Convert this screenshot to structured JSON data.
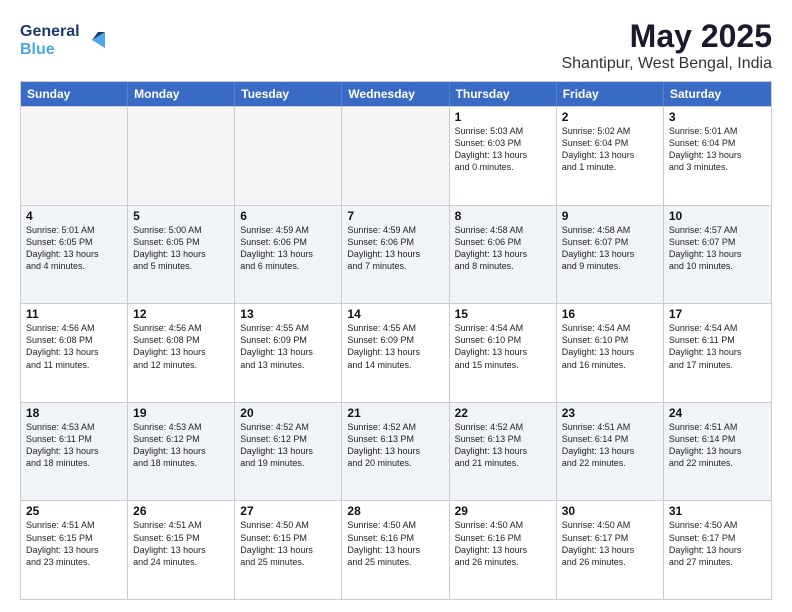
{
  "header": {
    "logo_line1": "General",
    "logo_line2": "Blue",
    "main_title": "May 2025",
    "subtitle": "Shantipur, West Bengal, India"
  },
  "weekdays": [
    "Sunday",
    "Monday",
    "Tuesday",
    "Wednesday",
    "Thursday",
    "Friday",
    "Saturday"
  ],
  "rows": [
    [
      {
        "day": "",
        "info": "",
        "empty": true
      },
      {
        "day": "",
        "info": "",
        "empty": true
      },
      {
        "day": "",
        "info": "",
        "empty": true
      },
      {
        "day": "",
        "info": "",
        "empty": true
      },
      {
        "day": "1",
        "info": "Sunrise: 5:03 AM\nSunset: 6:03 PM\nDaylight: 13 hours\nand 0 minutes."
      },
      {
        "day": "2",
        "info": "Sunrise: 5:02 AM\nSunset: 6:04 PM\nDaylight: 13 hours\nand 1 minute."
      },
      {
        "day": "3",
        "info": "Sunrise: 5:01 AM\nSunset: 6:04 PM\nDaylight: 13 hours\nand 3 minutes."
      }
    ],
    [
      {
        "day": "4",
        "info": "Sunrise: 5:01 AM\nSunset: 6:05 PM\nDaylight: 13 hours\nand 4 minutes."
      },
      {
        "day": "5",
        "info": "Sunrise: 5:00 AM\nSunset: 6:05 PM\nDaylight: 13 hours\nand 5 minutes."
      },
      {
        "day": "6",
        "info": "Sunrise: 4:59 AM\nSunset: 6:06 PM\nDaylight: 13 hours\nand 6 minutes."
      },
      {
        "day": "7",
        "info": "Sunrise: 4:59 AM\nSunset: 6:06 PM\nDaylight: 13 hours\nand 7 minutes."
      },
      {
        "day": "8",
        "info": "Sunrise: 4:58 AM\nSunset: 6:06 PM\nDaylight: 13 hours\nand 8 minutes."
      },
      {
        "day": "9",
        "info": "Sunrise: 4:58 AM\nSunset: 6:07 PM\nDaylight: 13 hours\nand 9 minutes."
      },
      {
        "day": "10",
        "info": "Sunrise: 4:57 AM\nSunset: 6:07 PM\nDaylight: 13 hours\nand 10 minutes."
      }
    ],
    [
      {
        "day": "11",
        "info": "Sunrise: 4:56 AM\nSunset: 6:08 PM\nDaylight: 13 hours\nand 11 minutes."
      },
      {
        "day": "12",
        "info": "Sunrise: 4:56 AM\nSunset: 6:08 PM\nDaylight: 13 hours\nand 12 minutes."
      },
      {
        "day": "13",
        "info": "Sunrise: 4:55 AM\nSunset: 6:09 PM\nDaylight: 13 hours\nand 13 minutes."
      },
      {
        "day": "14",
        "info": "Sunrise: 4:55 AM\nSunset: 6:09 PM\nDaylight: 13 hours\nand 14 minutes."
      },
      {
        "day": "15",
        "info": "Sunrise: 4:54 AM\nSunset: 6:10 PM\nDaylight: 13 hours\nand 15 minutes."
      },
      {
        "day": "16",
        "info": "Sunrise: 4:54 AM\nSunset: 6:10 PM\nDaylight: 13 hours\nand 16 minutes."
      },
      {
        "day": "17",
        "info": "Sunrise: 4:54 AM\nSunset: 6:11 PM\nDaylight: 13 hours\nand 17 minutes."
      }
    ],
    [
      {
        "day": "18",
        "info": "Sunrise: 4:53 AM\nSunset: 6:11 PM\nDaylight: 13 hours\nand 18 minutes."
      },
      {
        "day": "19",
        "info": "Sunrise: 4:53 AM\nSunset: 6:12 PM\nDaylight: 13 hours\nand 18 minutes."
      },
      {
        "day": "20",
        "info": "Sunrise: 4:52 AM\nSunset: 6:12 PM\nDaylight: 13 hours\nand 19 minutes."
      },
      {
        "day": "21",
        "info": "Sunrise: 4:52 AM\nSunset: 6:13 PM\nDaylight: 13 hours\nand 20 minutes."
      },
      {
        "day": "22",
        "info": "Sunrise: 4:52 AM\nSunset: 6:13 PM\nDaylight: 13 hours\nand 21 minutes."
      },
      {
        "day": "23",
        "info": "Sunrise: 4:51 AM\nSunset: 6:14 PM\nDaylight: 13 hours\nand 22 minutes."
      },
      {
        "day": "24",
        "info": "Sunrise: 4:51 AM\nSunset: 6:14 PM\nDaylight: 13 hours\nand 22 minutes."
      }
    ],
    [
      {
        "day": "25",
        "info": "Sunrise: 4:51 AM\nSunset: 6:15 PM\nDaylight: 13 hours\nand 23 minutes."
      },
      {
        "day": "26",
        "info": "Sunrise: 4:51 AM\nSunset: 6:15 PM\nDaylight: 13 hours\nand 24 minutes."
      },
      {
        "day": "27",
        "info": "Sunrise: 4:50 AM\nSunset: 6:15 PM\nDaylight: 13 hours\nand 25 minutes."
      },
      {
        "day": "28",
        "info": "Sunrise: 4:50 AM\nSunset: 6:16 PM\nDaylight: 13 hours\nand 25 minutes."
      },
      {
        "day": "29",
        "info": "Sunrise: 4:50 AM\nSunset: 6:16 PM\nDaylight: 13 hours\nand 26 minutes."
      },
      {
        "day": "30",
        "info": "Sunrise: 4:50 AM\nSunset: 6:17 PM\nDaylight: 13 hours\nand 26 minutes."
      },
      {
        "day": "31",
        "info": "Sunrise: 4:50 AM\nSunset: 6:17 PM\nDaylight: 13 hours\nand 27 minutes."
      }
    ]
  ]
}
